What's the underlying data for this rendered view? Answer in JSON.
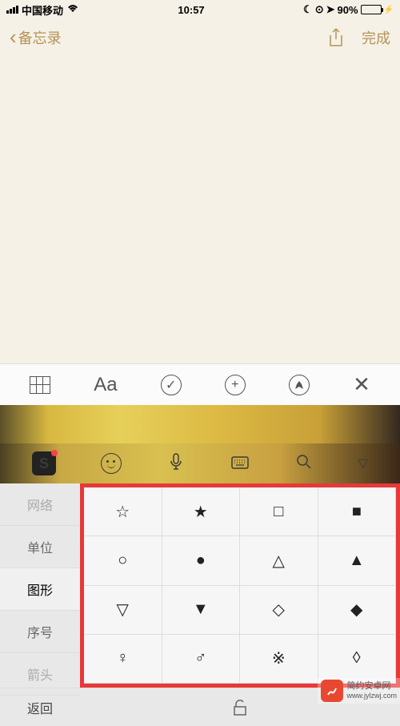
{
  "status": {
    "carrier": "中国移动",
    "time": "10:57",
    "battery_pct": "90%"
  },
  "nav": {
    "back_label": "备忘录",
    "done_label": "完成"
  },
  "toolbar": {
    "aa": "Aa",
    "check": "✓",
    "plus": "+"
  },
  "kb_toolbar": {
    "sogou": "S",
    "chevron": "▽"
  },
  "categories": [
    {
      "label": "网络",
      "active": false,
      "partial": true
    },
    {
      "label": "单位",
      "active": false
    },
    {
      "label": "图形",
      "active": true
    },
    {
      "label": "序号",
      "active": false
    },
    {
      "label": "箭头",
      "active": false,
      "partial": true
    }
  ],
  "symbols": [
    [
      "☆",
      "★",
      "□",
      "■"
    ],
    [
      "○",
      "●",
      "△",
      "▲"
    ],
    [
      "▽",
      "▼",
      "◇",
      "◆"
    ],
    [
      "♀",
      "♂",
      "※",
      "◊"
    ]
  ],
  "bottom": {
    "return_label": "返回",
    "lock": "🔓"
  },
  "watermark": {
    "title": "简约安卓网",
    "url": "www.jylzwj.com"
  }
}
